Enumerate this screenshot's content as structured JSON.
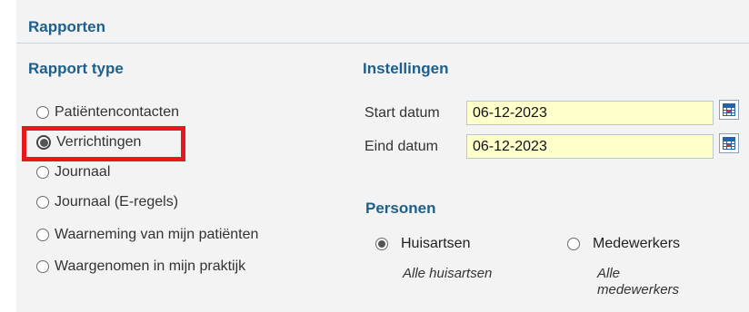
{
  "header": {
    "title": "Rapporten"
  },
  "rapport_type": {
    "title": "Rapport type",
    "options": [
      {
        "label": "Patiëntencontacten",
        "checked": false
      },
      {
        "label": "Verrichtingen",
        "checked": true
      },
      {
        "label": "Journaal",
        "checked": false
      },
      {
        "label": "Journaal (E-regels)",
        "checked": false
      },
      {
        "label": "Waarneming van mijn patiënten",
        "checked": false
      },
      {
        "label": "Waargenomen in mijn praktijk",
        "checked": false
      }
    ]
  },
  "instellingen": {
    "title": "Instellingen",
    "start_label": "Start datum",
    "start_value": "06-12-2023",
    "end_label": "Eind datum",
    "end_value": "06-12-2023"
  },
  "personen": {
    "title": "Personen",
    "huisartsen": {
      "label": "Huisartsen",
      "checked": true,
      "note": "Alle huisartsen"
    },
    "medewerkers": {
      "label": "Medewerkers",
      "checked": false,
      "note_line1": "Alle",
      "note_line2": "medewerkers"
    }
  },
  "colors": {
    "accent": "#1f5f8b",
    "input_bg": "#ffffcc",
    "highlight": "#e8161d"
  }
}
